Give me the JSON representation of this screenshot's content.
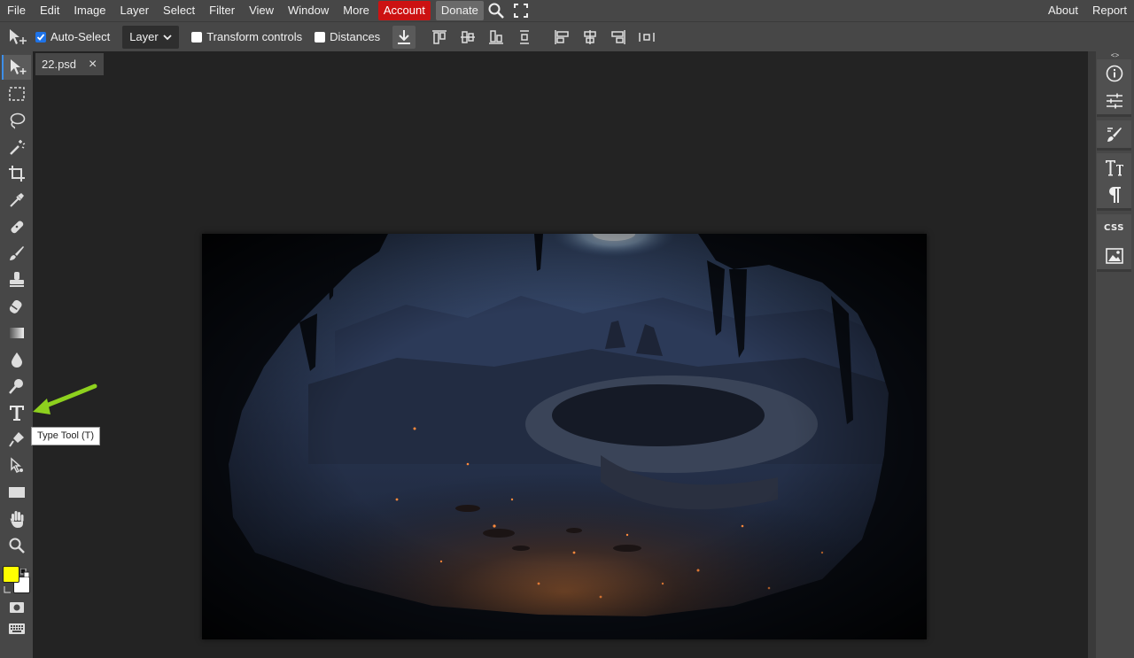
{
  "menu": {
    "items": [
      "File",
      "Edit",
      "Image",
      "Layer",
      "Select",
      "Filter",
      "View",
      "Window",
      "More"
    ],
    "account": "Account",
    "donate": "Donate",
    "right": [
      "About",
      "Report"
    ]
  },
  "options": {
    "auto_select": "Auto-Select",
    "auto_select_checked": true,
    "select_value": "Layer",
    "transform_controls": "Transform controls",
    "distances": "Distances"
  },
  "toolbar": {
    "tools": [
      "move-tool",
      "marquee-tool",
      "lasso-tool",
      "magic-wand-tool",
      "crop-tool",
      "eyedropper-tool",
      "healing-tool",
      "brush-tool",
      "clone-stamp-tool",
      "eraser-tool",
      "gradient-tool",
      "blur-tool",
      "dodge-tool",
      "type-tool",
      "pen-tool",
      "path-select-tool",
      "shape-tool",
      "hand-tool",
      "zoom-tool"
    ],
    "active_tool": "move-tool",
    "foreground_color": "#ffff00",
    "background_color": "#ffffff"
  },
  "document": {
    "tab_name": "22.psd",
    "close": "×"
  },
  "tooltip": "Type Tool (T)",
  "right_panel": {
    "css_label": "CSS",
    "icons": [
      "info-icon",
      "adjustments-icon",
      "brush-settings-icon",
      "character-icon",
      "paragraph-icon",
      "css-icon",
      "image-icon"
    ]
  },
  "colors": {
    "accent": "#3d8ee8",
    "account_bg": "#cc1212",
    "arrow": "#8ed11e"
  }
}
